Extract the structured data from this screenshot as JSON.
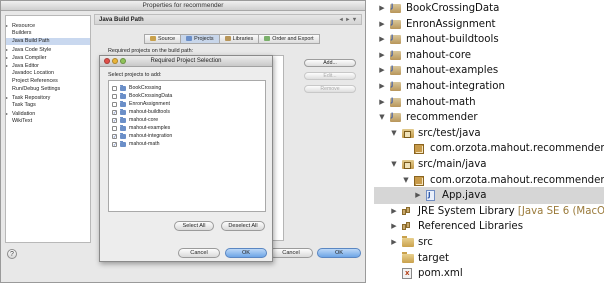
{
  "properties_window": {
    "title": "Properties for recommender",
    "tree": [
      {
        "label": "Resource",
        "expandable": true,
        "selected": false
      },
      {
        "label": "Builders",
        "expandable": false,
        "selected": false
      },
      {
        "label": "Java Build Path",
        "expandable": false,
        "selected": true
      },
      {
        "label": "Java Code Style",
        "expandable": true,
        "selected": false
      },
      {
        "label": "Java Compiler",
        "expandable": true,
        "selected": false
      },
      {
        "label": "Java Editor",
        "expandable": true,
        "selected": false
      },
      {
        "label": "Javadoc Location",
        "expandable": false,
        "selected": false
      },
      {
        "label": "Project References",
        "expandable": false,
        "selected": false
      },
      {
        "label": "Run/Debug Settings",
        "expandable": false,
        "selected": false
      },
      {
        "label": "Task Repository",
        "expandable": true,
        "selected": false
      },
      {
        "label": "Task Tags",
        "expandable": false,
        "selected": false
      },
      {
        "label": "Validation",
        "expandable": true,
        "selected": false
      },
      {
        "label": "WikiText",
        "expandable": false,
        "selected": false
      }
    ],
    "pane_title": "Java Build Path",
    "tabs": [
      {
        "label": "Source",
        "active": false,
        "color": "#c9a14c"
      },
      {
        "label": "Projects",
        "active": true,
        "color": "#6b8fc8"
      },
      {
        "label": "Libraries",
        "active": false,
        "color": "#b8965a"
      },
      {
        "label": "Order and Export",
        "active": false,
        "color": "#7bb06b"
      }
    ],
    "required_label": "Required projects on the build path:",
    "side_buttons": [
      {
        "label": "Add...",
        "enabled": true
      },
      {
        "label": "Edit...",
        "enabled": false
      },
      {
        "label": "Remove",
        "enabled": false
      }
    ],
    "help_glyph": "?",
    "cancel_label": "Cancel",
    "ok_label": "OK"
  },
  "dialog": {
    "title": "Required Project Selection",
    "prompt": "Select projects to add:",
    "projects": [
      {
        "name": "BookCrossing",
        "checked": false
      },
      {
        "name": "BookCrossingData",
        "checked": false
      },
      {
        "name": "EnronAssignment",
        "checked": false
      },
      {
        "name": "mahout-buildtools",
        "checked": true
      },
      {
        "name": "mahout-core",
        "checked": true
      },
      {
        "name": "mahout-examples",
        "checked": false
      },
      {
        "name": "mahout-integration",
        "checked": true
      },
      {
        "name": "mahout-math",
        "checked": true
      }
    ],
    "select_all_label": "Select All",
    "deselect_all_label": "Deselect All",
    "cancel_label": "Cancel",
    "ok_label": "OK",
    "traffic_colors": [
      "#e0504a",
      "#e9b43a",
      "#8fc35a"
    ]
  },
  "explorer": {
    "items": [
      {
        "label": "BookCrossingData",
        "extra": "",
        "icon": "java-project-icon",
        "depth": 0,
        "toggle": "collapsed",
        "selected": false
      },
      {
        "label": "EnronAssignment",
        "extra": "",
        "icon": "java-project-icon",
        "depth": 0,
        "toggle": "collapsed",
        "selected": false
      },
      {
        "label": "mahout-buildtools",
        "extra": "",
        "icon": "java-project-icon",
        "depth": 0,
        "toggle": "collapsed",
        "selected": false
      },
      {
        "label": "mahout-core",
        "extra": "",
        "icon": "java-project-icon",
        "depth": 0,
        "toggle": "collapsed",
        "selected": false
      },
      {
        "label": "mahout-examples",
        "extra": "",
        "icon": "java-project-icon",
        "depth": 0,
        "toggle": "collapsed",
        "selected": false
      },
      {
        "label": "mahout-integration",
        "extra": "",
        "icon": "java-project-icon",
        "depth": 0,
        "toggle": "collapsed",
        "selected": false
      },
      {
        "label": "mahout-math",
        "extra": "",
        "icon": "java-project-icon",
        "depth": 0,
        "toggle": "collapsed",
        "selected": false
      },
      {
        "label": "recommender",
        "extra": "",
        "icon": "java-project-icon",
        "depth": 0,
        "toggle": "expanded",
        "selected": false
      },
      {
        "label": "src/test/java",
        "extra": "",
        "icon": "source-folder-icon",
        "depth": 1,
        "toggle": "expanded",
        "selected": false
      },
      {
        "label": "com.orzota.mahout.recommender",
        "extra": "",
        "icon": "package-icon",
        "depth": 2,
        "toggle": "none",
        "selected": false
      },
      {
        "label": "src/main/java",
        "extra": "",
        "icon": "source-folder-icon",
        "depth": 1,
        "toggle": "expanded",
        "selected": false
      },
      {
        "label": "com.orzota.mahout.recommender",
        "extra": "",
        "icon": "package-icon",
        "depth": 2,
        "toggle": "expanded",
        "selected": false
      },
      {
        "label": "App.java",
        "extra": "",
        "icon": "java-file-icon",
        "depth": 3,
        "toggle": "collapsed",
        "selected": true
      },
      {
        "label": "JRE System Library",
        "extra": "[Java SE 6 (MacOS X",
        "icon": "jar-library-icon",
        "depth": 1,
        "toggle": "collapsed",
        "selected": false
      },
      {
        "label": "Referenced Libraries",
        "extra": "",
        "icon": "jar-library-icon",
        "depth": 1,
        "toggle": "collapsed",
        "selected": false
      },
      {
        "label": "src",
        "extra": "",
        "icon": "folder-icon",
        "depth": 1,
        "toggle": "collapsed",
        "selected": false
      },
      {
        "label": "target",
        "extra": "",
        "icon": "folder-icon",
        "depth": 1,
        "toggle": "none",
        "selected": false
      },
      {
        "label": "pom.xml",
        "extra": "",
        "icon": "xml-file-icon",
        "depth": 1,
        "toggle": "none",
        "selected": false
      }
    ]
  }
}
